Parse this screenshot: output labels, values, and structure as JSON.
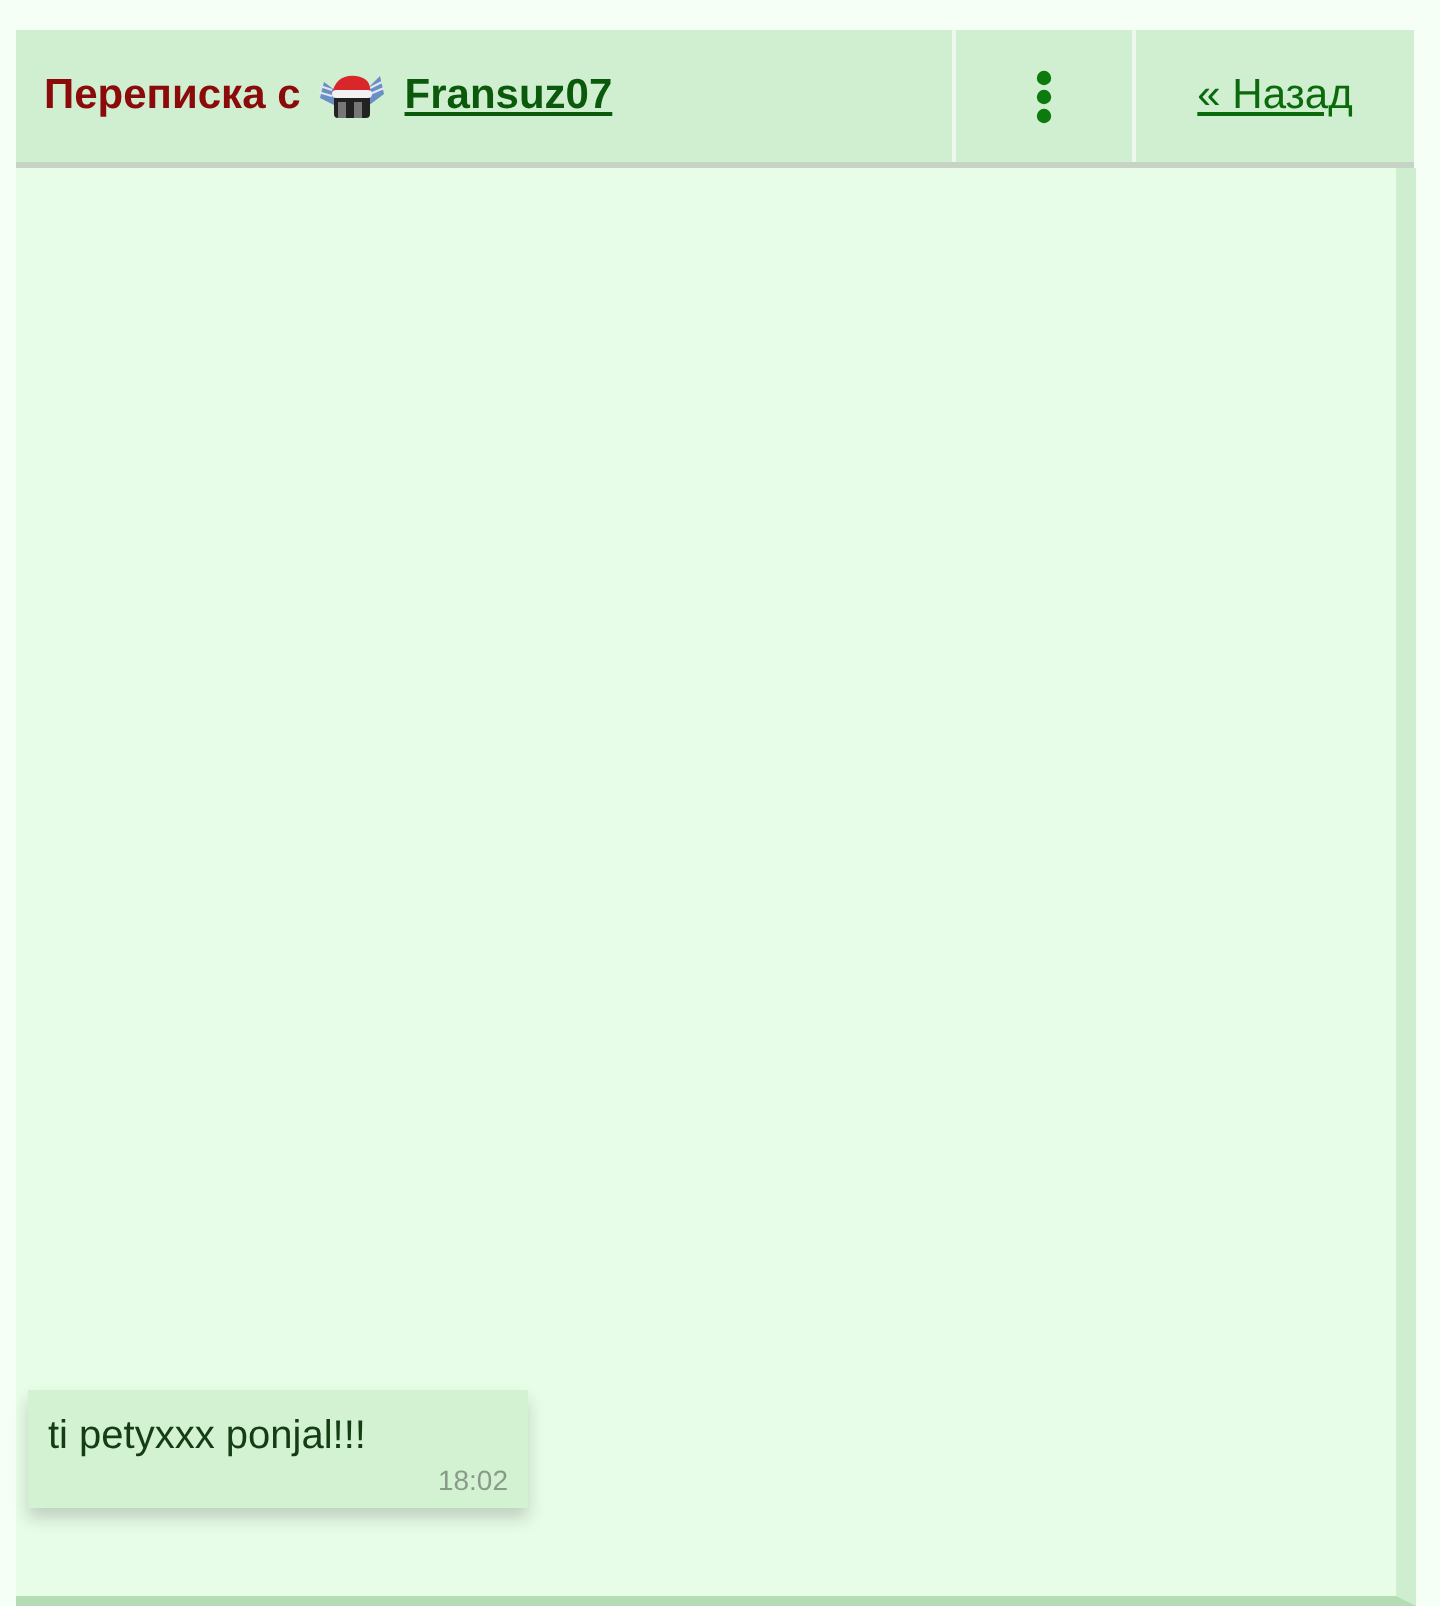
{
  "header": {
    "title": "Переписка с",
    "user": {
      "name": "Fransuz07"
    },
    "back_link": "« Назад"
  },
  "messages": [
    {
      "text": "ti petyxxx ponjal!!!",
      "time": "18:02"
    }
  ]
}
